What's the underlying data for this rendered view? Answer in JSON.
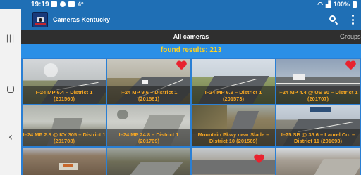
{
  "status_bar": {
    "time": "19:19",
    "temp": "4°",
    "battery": "100%"
  },
  "app_bar": {
    "title": "Cameras Kentucky",
    "icons": [
      "search-icon",
      "more-vert-icon"
    ]
  },
  "tabs": {
    "active": "All cameras",
    "other": "Groups"
  },
  "results": {
    "text": "found results: 213"
  },
  "colors": {
    "primary": "#1f6fb5",
    "accent_bar": "#2b8fe6",
    "results_text": "#ffd21f",
    "caption_text": "#f5a623",
    "favorite": "#e8232f"
  },
  "cameras": [
    {
      "line1": "I–24 MP 6.4 – District 1",
      "line2": "(201560)",
      "favorite": false
    },
    {
      "line1": "I–24 MP 9.6 – District 1",
      "line2": "(201561)",
      "favorite": true
    },
    {
      "line1": "I–24 MP 6.9 – District 1",
      "line2": "(201573)",
      "favorite": false
    },
    {
      "line1": "I–24 MP 4.4 @ US 60 – District 1",
      "line2": "(201707)",
      "favorite": true
    },
    {
      "line1": "I–24 MP 2.8 @ KY 305 – District 1",
      "line2": "(201708)",
      "favorite": false
    },
    {
      "line1": "I–24 MP 24.8 – District 1",
      "line2": "(201709)",
      "favorite": false
    },
    {
      "line1": "Mountain Pkwy near Slade –",
      "line2": "District 10 (201569)",
      "favorite": false
    },
    {
      "line1": "I–75 SB @ 35.6 – Laurel Co. –",
      "line2": "District 11 (201693)",
      "favorite": false
    },
    {
      "line1": "",
      "line2": "",
      "favorite": false
    },
    {
      "line1": "",
      "line2": "",
      "favorite": false
    },
    {
      "line1": "",
      "line2": "",
      "favorite": true
    },
    {
      "line1": "",
      "line2": "",
      "favorite": false
    }
  ]
}
